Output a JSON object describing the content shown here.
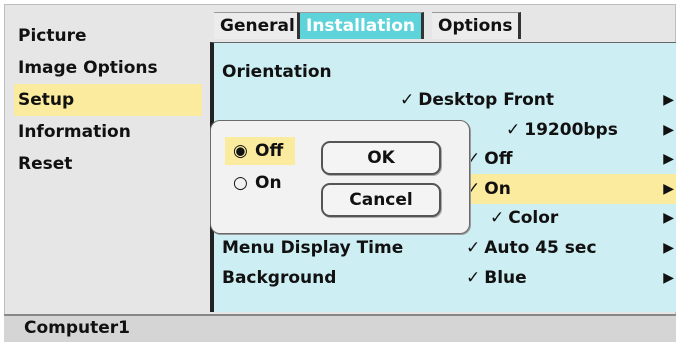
{
  "left_menu": {
    "items": [
      {
        "label": "Picture"
      },
      {
        "label": "Image Options"
      },
      {
        "label": "Setup"
      },
      {
        "label": "Information"
      },
      {
        "label": "Reset"
      }
    ],
    "selected_index": 2
  },
  "tabs": [
    {
      "label": "General"
    },
    {
      "label": "Installation"
    },
    {
      "label": "Options"
    }
  ],
  "active_tab": "Installation",
  "settings": {
    "orientation_label": "Orientation",
    "rows": [
      {
        "label": "",
        "value": "Desktop Front"
      },
      {
        "label": "",
        "value": "19200bps"
      },
      {
        "label": "",
        "value": "Off"
      },
      {
        "label": "",
        "value": "On"
      },
      {
        "label": "",
        "value": "Color"
      },
      {
        "label": "Menu Display Time",
        "value": "Auto 45 sec"
      },
      {
        "label": "Background",
        "value": "Blue"
      }
    ],
    "highlighted_row_value": "On"
  },
  "dialog": {
    "options": [
      {
        "label": "Off",
        "checked": true
      },
      {
        "label": "On",
        "checked": false
      }
    ],
    "ok_label": "OK",
    "cancel_label": "Cancel"
  },
  "status": {
    "source": "Computer1"
  },
  "glyphs": {
    "check": "✓",
    "arrow": "▶",
    "radio_on": "◉",
    "radio_off": "○"
  },
  "colors": {
    "panel": "#cdeef3",
    "highlight": "#fbeb9e",
    "active_tab": "#5fd3da"
  }
}
